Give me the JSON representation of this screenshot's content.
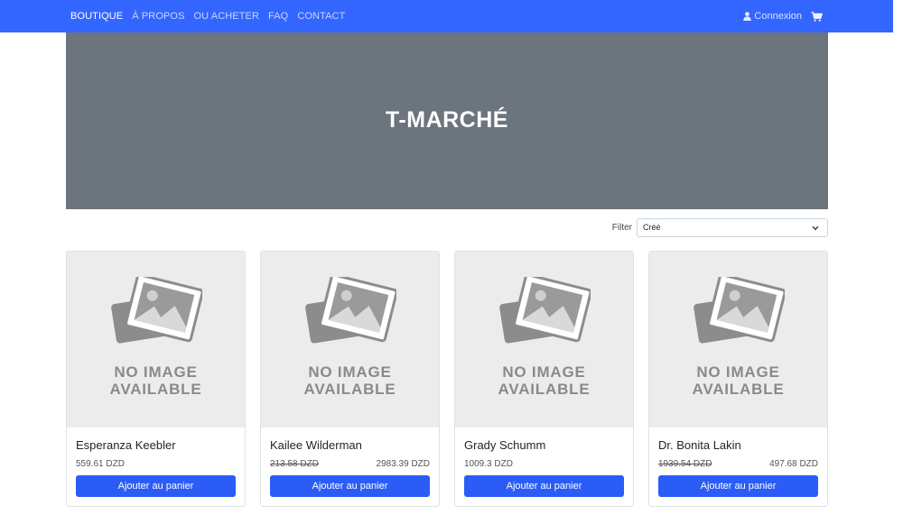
{
  "nav": {
    "links": [
      {
        "label": "BOUTIQUE",
        "active": true
      },
      {
        "label": "À PROPOS",
        "active": false
      },
      {
        "label": "OU ACHETER",
        "active": false
      },
      {
        "label": "FAQ",
        "active": false
      },
      {
        "label": "CONTACT",
        "active": false
      }
    ],
    "login_label": "Connexion",
    "user_icon": "user-icon",
    "cart_icon": "cart-icon"
  },
  "hero": {
    "title": "T-MARCHÉ"
  },
  "filter": {
    "label": "Filter",
    "selected": "Créé"
  },
  "products": [
    {
      "name": "Esperanza Keebler",
      "price": "559.61 DZD",
      "old_price": "",
      "new_price": "",
      "image_line1": "NO IMAGE",
      "image_line2": "AVAILABLE",
      "button": "Ajouter au panier"
    },
    {
      "name": "Kailee Wilderman",
      "price": "",
      "old_price": "213.58 DZD",
      "new_price": "2983.39 DZD",
      "image_line1": "NO IMAGE",
      "image_line2": "AVAILABLE",
      "button": "Ajouter au panier"
    },
    {
      "name": "Grady Schumm",
      "price": "1009.3 DZD",
      "old_price": "",
      "new_price": "",
      "image_line1": "NO IMAGE",
      "image_line2": "AVAILABLE",
      "button": "Ajouter au panier"
    },
    {
      "name": "Dr. Bonita Lakin",
      "price": "",
      "old_price": "1939.54 DZD",
      "new_price": "497.68 DZD",
      "image_line1": "NO IMAGE",
      "image_line2": "AVAILABLE",
      "button": "Ajouter au panier"
    }
  ],
  "colors": {
    "navbar": "#3366ff",
    "hero": "#6c757d",
    "button": "#2b5cf6",
    "image_bg": "#ececec"
  }
}
